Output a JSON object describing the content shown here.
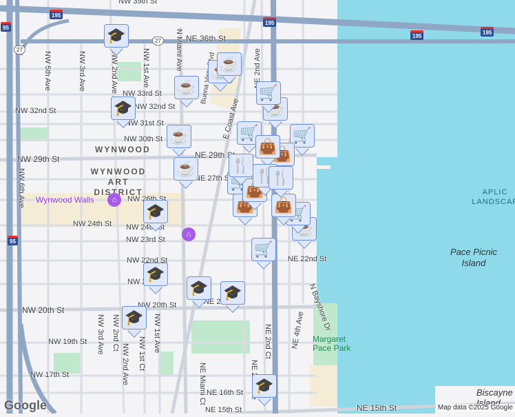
{
  "map": {
    "colors": {
      "land": "#f4f3f5",
      "water": "#8ed9ea",
      "park": "#bfe8cc",
      "highway": "#8fa6c4",
      "road": "#dadde3",
      "commercial": "#f5ecd6"
    },
    "highways": [
      "195",
      "195",
      "195",
      "195",
      "95",
      "95"
    ],
    "us_routes": [
      "27",
      "27"
    ],
    "streets": [
      "NW 39th St",
      "NE 36th St",
      "N Miami Ave",
      "NW 5th Ave",
      "NW 3rd Ave",
      "NW 2nd Ave",
      "NW 1st Ave",
      "NW 33rd St",
      "NW 32nd St",
      "NW 32nd St",
      "NW 31st St",
      "NW 30th St",
      "NW 29th St",
      "NE 29th St",
      "NE 27th St",
      "NW 26th St",
      "NW 24th St",
      "NW 24th St",
      "NW 23rd St",
      "NW 22nd St",
      "NW 21st St",
      "NW 20th St",
      "NW 20th St",
      "NE 20th St",
      "NW 19th St",
      "NW 17th St",
      "NE 16th St",
      "NE 15th St",
      "NE 15th St",
      "NW 6th Ave",
      "NW 3rd Ave",
      "NW 2nd Ct",
      "NW 2nd Ave",
      "NW 1st Ct",
      "NW 1st Ave",
      "NE Miami Ct",
      "NE 2nd Ave",
      "NE 2nd Ave",
      "NE 2nd Ct",
      "NE 4th Ave",
      "N Bayshore Dr",
      "NE 22nd St",
      "E Coast Ave",
      "Buena Vista Blvd"
    ],
    "districts": [
      "WYNWOOD",
      "WYNWOOD ART DISTRICT"
    ],
    "poi": "Wynwood Walls",
    "park": "Margaret Pace Park",
    "islands": [
      "Pace Picnic Island",
      "Biscayne Island"
    ],
    "landscape_label": "APLIC LANDSCAP",
    "attribution": "Map data ©2025 Google",
    "logo": "Google"
  },
  "markers": [
    "education",
    "education",
    "education",
    "education",
    "education",
    "education",
    "education",
    "education",
    "coffee",
    "coffee",
    "coffee",
    "coffee",
    "coffee",
    "coffee",
    "coffee",
    "shopping-cart",
    "shopping-cart",
    "shopping-cart",
    "shopping-cart",
    "shopping-cart",
    "shopping-cart",
    "shopping-bag",
    "shopping-bag",
    "shopping-bag",
    "shopping-bag",
    "shopping-bag",
    "restaurant",
    "restaurant",
    "restaurant"
  ]
}
